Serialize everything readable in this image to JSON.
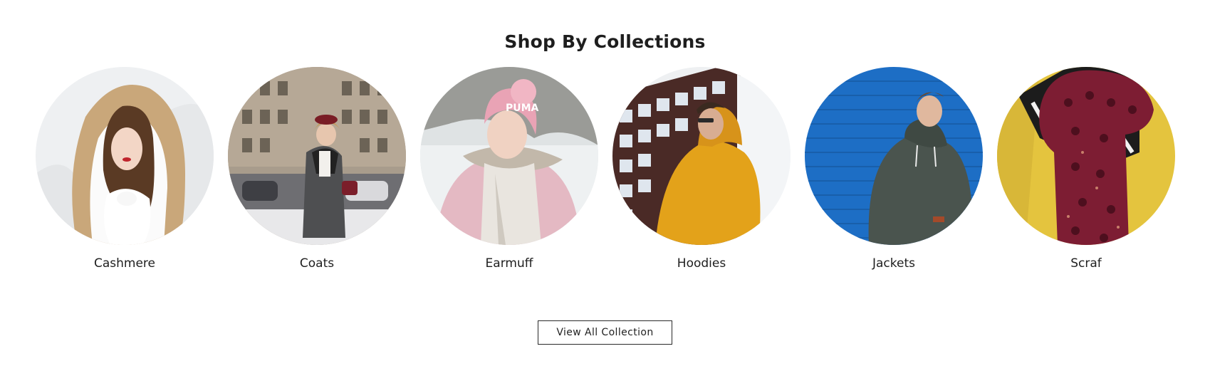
{
  "section": {
    "title": "Shop By Collections",
    "button_label": "View All Collection"
  },
  "collections": [
    {
      "label": "Cashmere",
      "image": "woman-in-beige-hood-with-snow-photo"
    },
    {
      "label": "Coats",
      "image": "woman-in-grey-coat-on-city-street-photo"
    },
    {
      "label": "Earmuff",
      "image": "woman-in-pink-beanie-and-scarf-photo"
    },
    {
      "label": "Hoodies",
      "image": "man-in-yellow-hoodie-photo"
    },
    {
      "label": "Jackets",
      "image": "man-in-green-jacket-against-blue-wall-photo"
    },
    {
      "label": "Scraf",
      "image": "knitted-burgundy-scarf-photo"
    }
  ]
}
